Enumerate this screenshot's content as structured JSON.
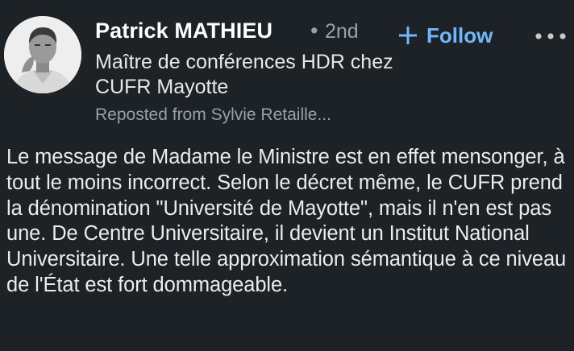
{
  "author": {
    "name": "Patrick MATHIEU",
    "degree_separator": "•",
    "degree": "2nd",
    "headline": "Maître de conférences HDR chez CUFR Mayotte",
    "repost_note": "Reposted from Sylvie Retaille...",
    "avatar_icon": "person-portrait-avatar"
  },
  "actions": {
    "follow_label": "Follow",
    "follow_icon": "plus-icon",
    "more_icon": "more-options-icon",
    "accent_color": "#71b7fb"
  },
  "post": {
    "text": "Le message de Madame le Ministre est en effet mensonger, à tout le moins incorrect. Selon le décret même, le CUFR prend la dénomination \"Université de Mayotte\", mais il n'en est pas une. De Centre Universitaire, il devient un Institut National Universitaire. Une telle approximation sémantique à ce niveau de l'État est fort dommageable."
  },
  "theme": {
    "background": "#1d2226",
    "primary_text": "#ffffff",
    "secondary_text": "#9aa0a6"
  }
}
